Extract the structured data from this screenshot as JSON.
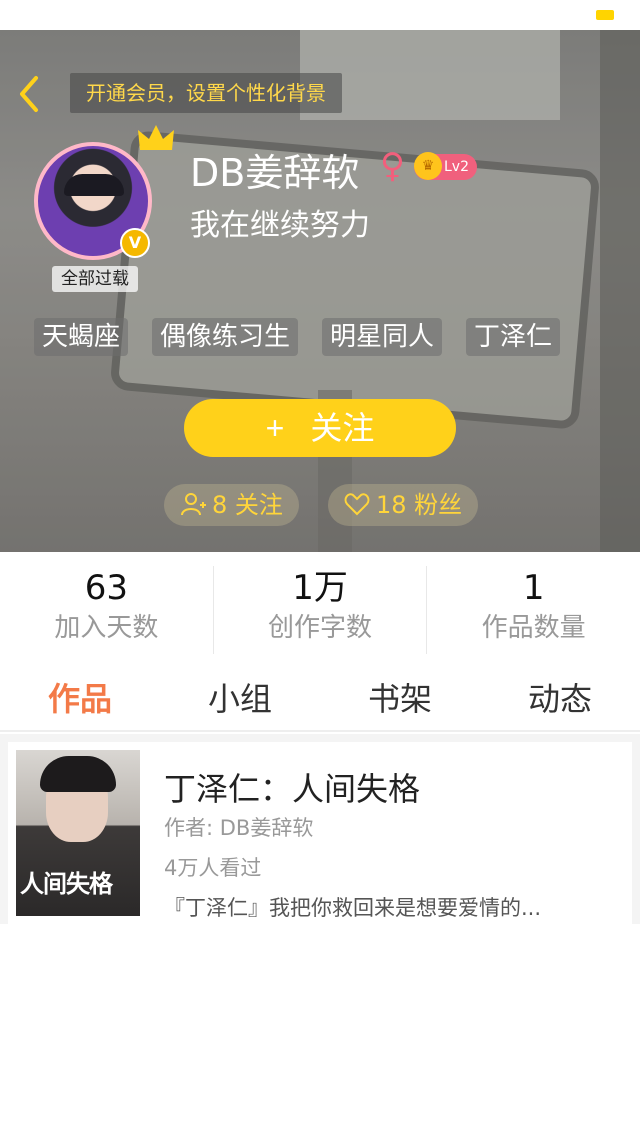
{
  "colors": {
    "accent": "#ffd11a",
    "active_tab": "#f37a48",
    "promo_text": "#ffd84a",
    "female": "#f25f7c"
  },
  "header": {
    "promo_text": "开通会员，设置个性化背景",
    "back_icon": "chevron-left-icon"
  },
  "profile": {
    "reprint_label": "全部过载",
    "username": "DB姜辞软",
    "gender_symbol": "♀",
    "level": "Lv2",
    "signature": "我在继续努力",
    "tags": [
      "天蝎座",
      "偶像练习生",
      "明星同人",
      "丁泽仁"
    ],
    "follow_plus": "+",
    "follow_label": "关注",
    "following_text": "8 关注",
    "fans_text": "18 粉丝"
  },
  "stats": [
    {
      "value": "63",
      "label": "加入天数"
    },
    {
      "value": "1万",
      "label": "创作字数"
    },
    {
      "value": "1",
      "label": "作品数量"
    }
  ],
  "tabs": [
    "作品",
    "小组",
    "书架",
    "动态"
  ],
  "active_tab": "作品",
  "works": [
    {
      "cover_text": "人间失格",
      "title": "丁泽仁：人间失格",
      "author": "作者: DB姜辞软",
      "views": "4万人看过",
      "excerpt": "『丁泽仁』我把你救回来是想要爱情的..."
    }
  ]
}
